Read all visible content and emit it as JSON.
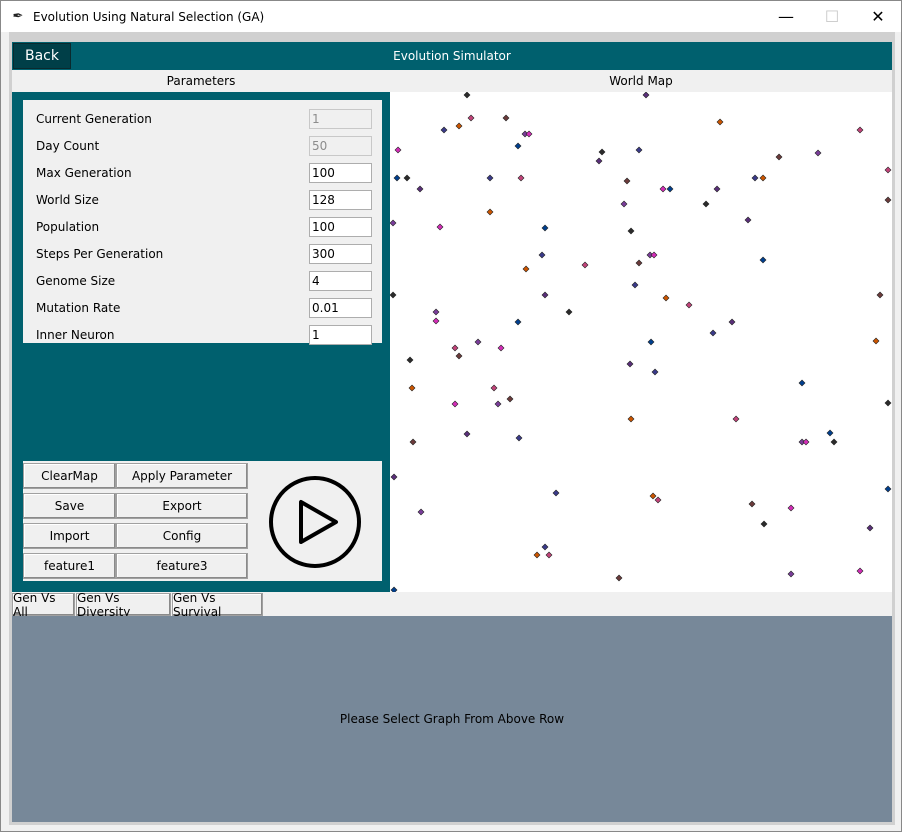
{
  "window": {
    "title": "Evolution Using Natural Selection (GA)",
    "controls": {
      "minimize": "—",
      "maximize": "☐",
      "close": "✕"
    }
  },
  "header": {
    "back_label": "Back",
    "app_title": "Evolution Simulator",
    "bg_color": "#00606e"
  },
  "sections": {
    "parameters": "Parameters",
    "world_map": "World Map"
  },
  "parameters": [
    {
      "label": "Current Generation",
      "value": "1",
      "readonly": true
    },
    {
      "label": "Day Count",
      "value": "50",
      "readonly": true
    },
    {
      "label": "Max Generation",
      "value": "100",
      "readonly": false
    },
    {
      "label": "World Size",
      "value": "128",
      "readonly": false
    },
    {
      "label": "Population",
      "value": "100",
      "readonly": false
    },
    {
      "label": "Steps Per Generation",
      "value": "300",
      "readonly": false
    },
    {
      "label": "Genome Size",
      "value": "4",
      "readonly": false
    },
    {
      "label": "Mutation Rate",
      "value": "0.01",
      "readonly": false
    },
    {
      "label": "Inner Neuron",
      "value": "1",
      "readonly": false
    }
  ],
  "buttons": {
    "clearmap": "ClearMap",
    "apply": "Apply Parameter",
    "save": "Save",
    "export": "Export",
    "import": "Import",
    "config": "Config",
    "feature1": "feature1",
    "feature3": "feature3"
  },
  "play_icon": "play-circle-icon",
  "map_colors": [
    "#7a3d9a",
    "#5a2f7a",
    "#6b3b3b",
    "#2b2b2b",
    "#c2447a",
    "#003f8f",
    "#cc5500",
    "#d42cb8",
    "#3a3a8a"
  ],
  "tabs": [
    "Gen Vs All",
    "Gen Vs Diversity",
    "Gen Vs Survival"
  ],
  "graph": {
    "message": "Please Select Graph From Above Row",
    "bg_color": "#778899"
  }
}
